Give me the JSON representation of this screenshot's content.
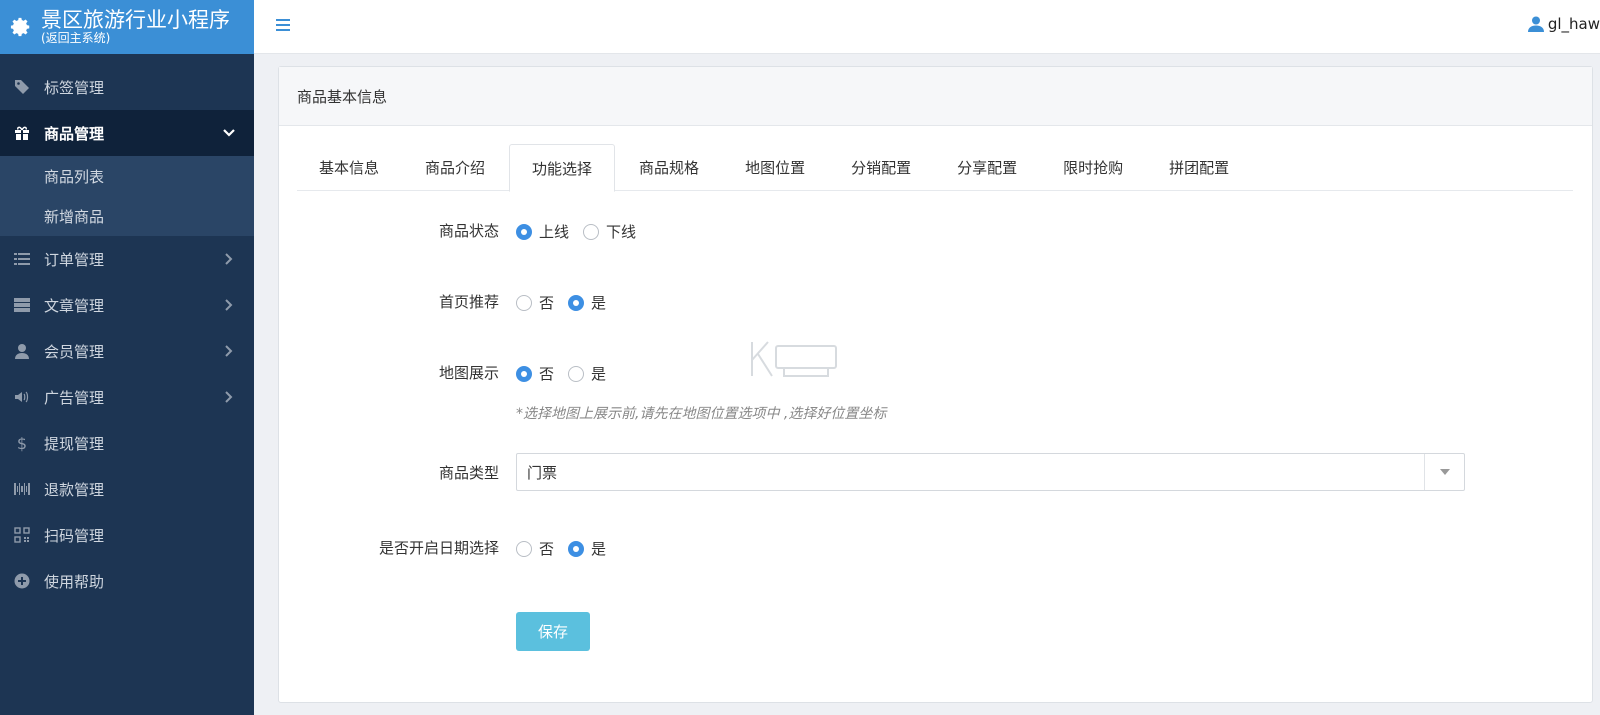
{
  "app": {
    "title": "景区旅游行业小程序",
    "subtitle": "(返回主系统)"
  },
  "sidebar": {
    "items": [
      {
        "label": "标签管理",
        "icon": "tag-icon"
      },
      {
        "label": "商品管理",
        "icon": "gift-icon",
        "active": true,
        "expanded": true,
        "children": [
          {
            "label": "商品列表"
          },
          {
            "label": "新增商品"
          }
        ]
      },
      {
        "label": "订单管理",
        "icon": "list-icon"
      },
      {
        "label": "文章管理",
        "icon": "server-icon"
      },
      {
        "label": "会员管理",
        "icon": "user-icon"
      },
      {
        "label": "广告管理",
        "icon": "volume-icon"
      },
      {
        "label": "提现管理",
        "icon": "dollar-icon"
      },
      {
        "label": "退款管理",
        "icon": "barcode-icon"
      },
      {
        "label": "扫码管理",
        "icon": "qrcode-icon"
      },
      {
        "label": "使用帮助",
        "icon": "plus-circle-icon"
      }
    ]
  },
  "topbar": {
    "user": "gl_haw"
  },
  "card": {
    "title": "商品基本信息",
    "tabs": [
      "基本信息",
      "商品介绍",
      "功能选择",
      "商品规格",
      "地图位置",
      "分销配置",
      "分享配置",
      "限时抢购",
      "拼团配置"
    ],
    "active_tab": "功能选择"
  },
  "form": {
    "status": {
      "label": "商品状态",
      "options": [
        "上线",
        "下线"
      ],
      "selected": "上线"
    },
    "home_recommend": {
      "label": "首页推荐",
      "options": [
        "否",
        "是"
      ],
      "selected": "是"
    },
    "map_display": {
      "label": "地图展示",
      "options": [
        "否",
        "是"
      ],
      "selected": "否",
      "hint": "*选择地图上展示前,请先在地图位置选项中 ,选择好位置坐标"
    },
    "product_type": {
      "label": "商品类型",
      "value": "门票"
    },
    "date_select": {
      "label": "是否开启日期选择",
      "options": [
        "否",
        "是"
      ],
      "selected": "是"
    },
    "save_label": "保存"
  },
  "colors": {
    "sidebar_bg": "#1d3553",
    "brand_bg": "#3b8fd6",
    "radio_on": "#3d8fe3",
    "save_btn": "#5bc0de"
  }
}
